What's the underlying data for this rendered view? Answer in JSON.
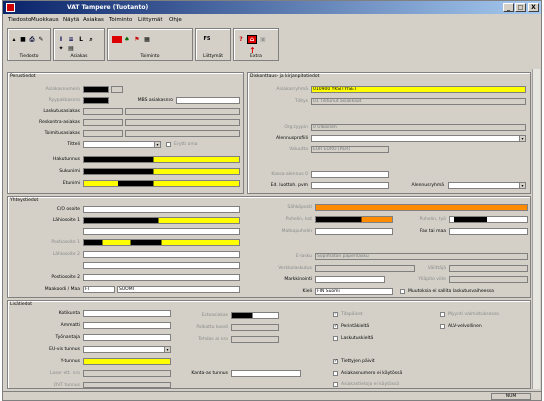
{
  "window": {
    "title": "VAT Tampere (Tuotanto)",
    "minimize": "_",
    "maximize": "□",
    "close": "X"
  },
  "menubar": [
    "Tiedosto",
    "Muokkaus",
    "Näytä",
    "Asiakas",
    "Toiminto",
    "Liittymät",
    "Ohje"
  ],
  "toolbar": {
    "groups": [
      {
        "label": "Tiedosto",
        "icons": [
          "new-icon",
          "save-icon",
          "print-icon",
          "edit-icon"
        ]
      },
      {
        "label": "Asiakas",
        "icons": [
          "info-icon",
          "list-icon",
          "link-icon",
          "search-icon",
          "extra-icon",
          "doc-icon"
        ]
      },
      {
        "label": "Toiminto",
        "icons": [
          "red-action-icon",
          "tree-icon",
          "flag-icon",
          "table-icon"
        ]
      },
      {
        "label": "Liittymät",
        "icons": [
          "fs-icon"
        ]
      },
      {
        "label": "Extra",
        "icons": [
          "help-icon",
          "home-icon",
          "disabled-icon"
        ]
      }
    ],
    "fs_text": "FS"
  },
  "perustiedot": {
    "title": "Perustiedot",
    "labels": {
      "asiakasnumero": "Asiakasnumero",
      "ryypakkasnro": "Ryypakkasnro",
      "mbs": "MBS asiakasnro",
      "laskutus": "Laskutusasiakas",
      "reskontra": "Reskontra-asiakas",
      "toimitus": "Toimitusasiakas",
      "titteli": "Titteli",
      "yritys": "Erytti oma",
      "hakutunnus": "Hakutunnus",
      "sukunimi": "Sukunimi",
      "etunimi": "Etunimi"
    }
  },
  "diskonttaus": {
    "title": "Diskonttaus- ja kirjanpitotiedot",
    "asiakasryhma_label": "Asiakasryhmä",
    "asiakasryhma_value": "010900 YKSITYISET",
    "tilityksen_label": "Tilitys",
    "tilityksen_value": "01 Tilitunut asiakkaat",
    "org_label": "Org.tyypin",
    "org_value": "0 Ulkoinen",
    "alennus_label": "Alennusprofiili",
    "valuutta_label": "Valuutta",
    "valuutta_value": "EUR EURO (PER)",
    "kassa_label": "Kassa-alennus 0",
    "ed_label": "Ed. luottoh. pvm",
    "alennushinta_label": "Alennusryhmä"
  },
  "yhteystiedot": {
    "title": "Yhteystiedot",
    "co_label": "C/O osoite",
    "lahiosoite1_label": "Lähiosoite 1",
    "postiosoite1_label": "Postiosoite 1",
    "lahiosoite2_label": "Lähiosoite 2",
    "postiosoite2_label": "Postiosoite 2",
    "maakoodi_label": "Maakoodi / Maa",
    "maakoodi_value": "FI",
    "maa_value": "SUOMI",
    "sahkoposti_label": "Sähköposti",
    "matkapuhelin_label": "Matkapuhelin",
    "puhelin_kot_label": "Puhelin, kot",
    "puhelin_tyo_label": "Puhelin, työ",
    "faksi_label": "Fax tai maa",
    "e_laskutus_label": "E-lasku",
    "e_laskutus_value": "Sopimaton paperilasku",
    "verkkolaskutus_label": "Verkkolaskutus",
    "valitajaa_label": "Välittäjä",
    "verkkolaskuosoite_label": "Ylläpito viite",
    "markkinointi_label": "Markkinointi",
    "kieli_label": "Kieli",
    "kieli_value": "FIN Suomi",
    "muutos_label": "Muutoksia ei sallita laskutusvaiheessa"
  },
  "lisatiedot": {
    "title": "Lisätiedot",
    "labels": [
      "Kotikunta",
      "Ammatti",
      "Työnantaja",
      "EU-vis tunnus",
      "Y-tunnus",
      "Laser ett. nro",
      "OVT tunnus"
    ],
    "mid_labels": [
      "Estoasiakas",
      "Palkattu koodi",
      "Tehdas ai nro"
    ],
    "kantaasiakas_label": "Kanta-as tunnus",
    "checks_mid": [
      "Tilapäiset",
      "Perintäkieltä",
      "Laskutuskieltä",
      "",
      "Tiettyjen päivit",
      "Asiakasnumero ei käytössä",
      "Asiakastietoja ei käytössä"
    ],
    "checks_right": [
      "Myynti valmistuksessa",
      "ALV-velvollinen"
    ]
  },
  "status": {
    "num": "NUM"
  }
}
